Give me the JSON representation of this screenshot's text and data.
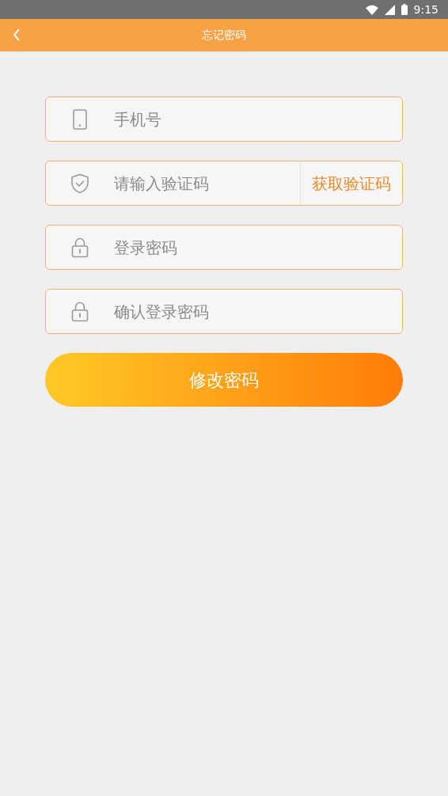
{
  "status_bar": {
    "time": "9:15"
  },
  "header": {
    "title": "忘记密码"
  },
  "fields": [
    {
      "kind": "phone",
      "placeholder": "手机号"
    },
    {
      "kind": "code",
      "placeholder": "请输入验证码",
      "action": "获取验证码"
    },
    {
      "kind": "password",
      "placeholder": "登录密码"
    },
    {
      "kind": "password",
      "placeholder": "确认登录密码"
    }
  ],
  "submit": "修改密码"
}
